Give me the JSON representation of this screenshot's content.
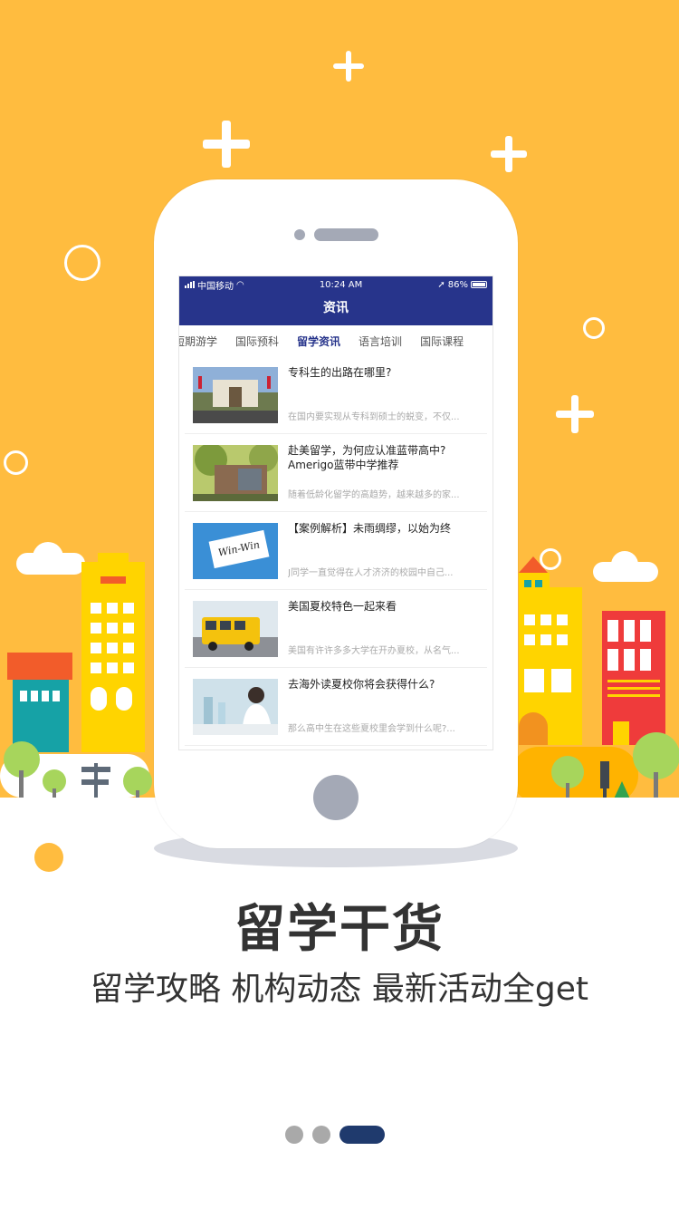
{
  "colors": {
    "background": "#ffbc3f",
    "appbar": "#27348b",
    "accent_dot": "#1f3a6d"
  },
  "status": {
    "carrier": "中国移动",
    "time": "10:24 AM",
    "battery": "86%"
  },
  "app": {
    "title": "资讯",
    "tabs": [
      {
        "label": "短期游学",
        "active": false
      },
      {
        "label": "国际预科",
        "active": false
      },
      {
        "label": "留学资讯",
        "active": true
      },
      {
        "label": "语言培训",
        "active": false
      },
      {
        "label": "国际课程",
        "active": false
      }
    ],
    "news": [
      {
        "title": "专科生的出路在哪里?",
        "summary": "在国内要实现从专科到硕士的蜕变，不仅..."
      },
      {
        "title": "赴美留学，为何应认准蓝带高中?Amerigo蓝带中学推荐",
        "summary": "随着低龄化留学的高趋势，越来越多的家..."
      },
      {
        "title": "【案例解析】未雨绸缪，以始为终",
        "summary": "J同学一直觉得在人才济济的校园中自己...",
        "image_text": "Win-Win"
      },
      {
        "title": "美国夏校特色一起来看",
        "summary": "美国有许许多多大学在开办夏校，从名气..."
      },
      {
        "title": "去海外读夏校你将会获得什么?",
        "summary": "那么高中生在这些夏校里会学到什么呢?..."
      }
    ]
  },
  "headline": "留学干货",
  "subline": "留学攻略 机构动态 最新活动全get",
  "pager": {
    "total": 3,
    "current": 3
  }
}
